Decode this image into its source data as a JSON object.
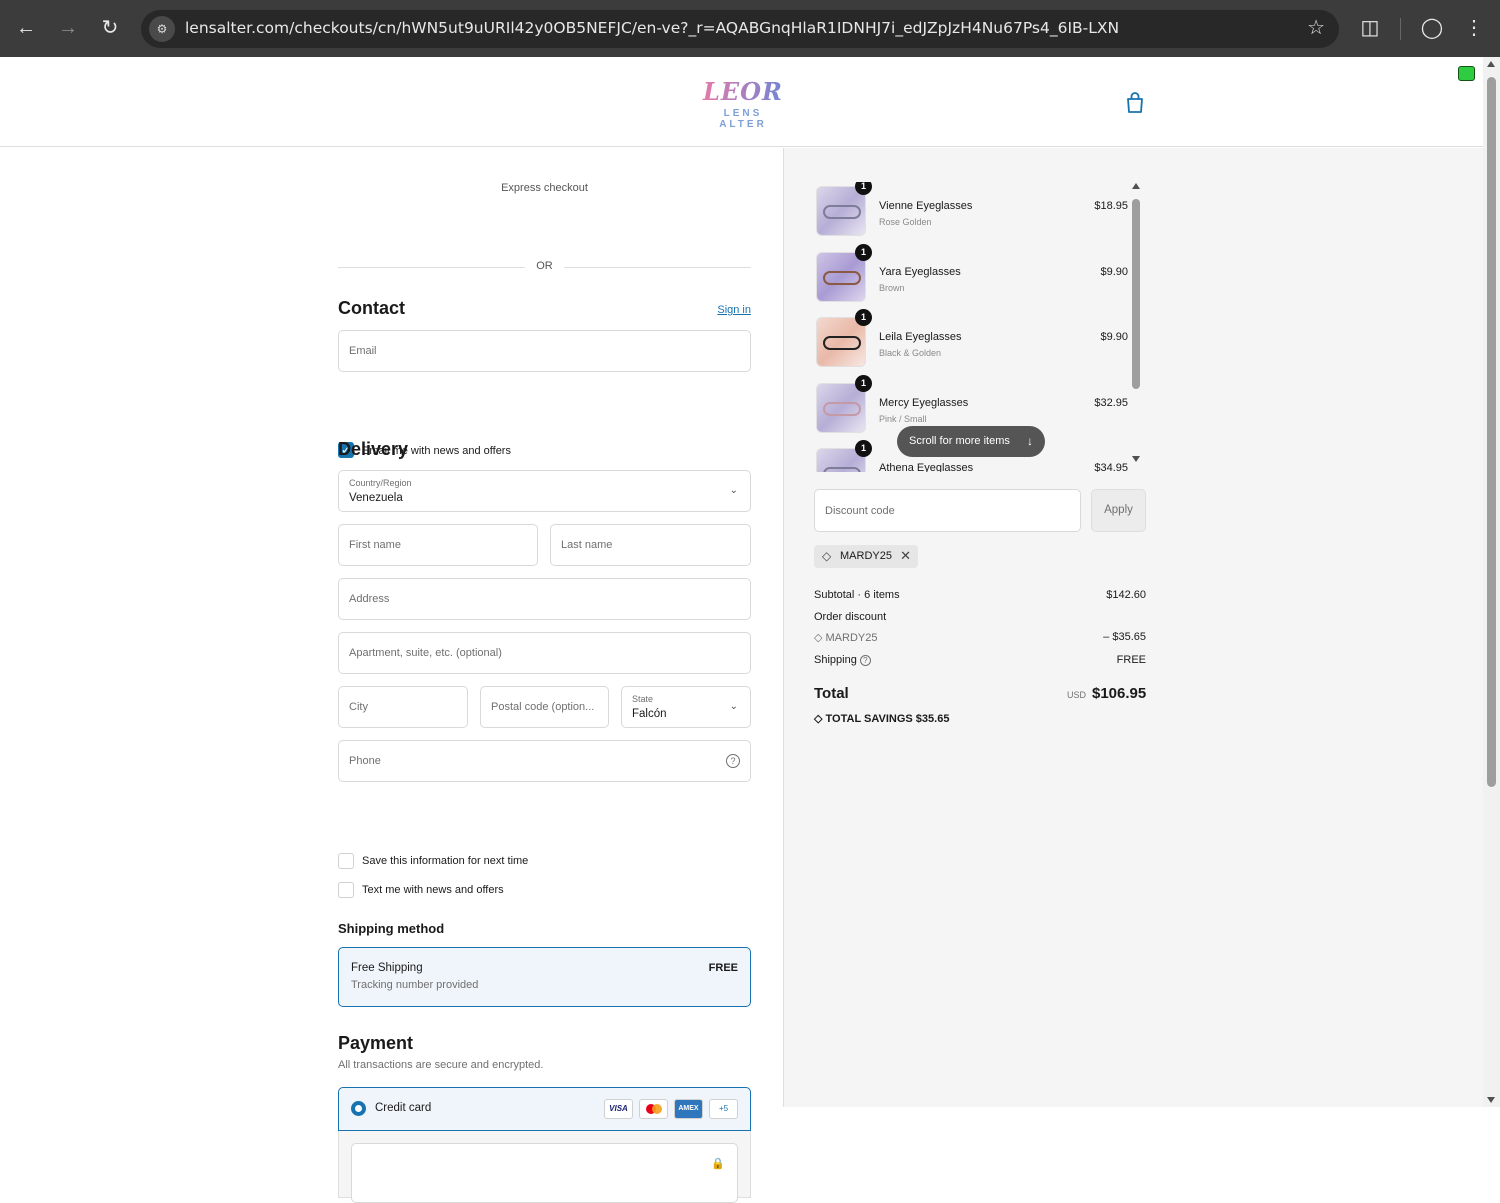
{
  "browser": {
    "url": "lensalter.com/checkouts/cn/hWN5ut9uURIl42y0OB5NEFJC/en-ve?_r=AQABGnqHlaR1IDNHJ7i_edJZpJzH4Nu67Ps4_6IB-LXN",
    "back_icon": "arrow-left-icon",
    "forward_icon": "arrow-right-icon",
    "reload_icon": "reload-icon",
    "bookmark_icon": "star-icon",
    "extensions_icon": "puzzle-icon",
    "profile_icon": "profile-icon",
    "menu_icon": "kebab-menu-icon"
  },
  "header": {
    "logo_mark": "LEOR",
    "logo_word": "LENS ALTER",
    "cart_icon": "shopping-bag-icon"
  },
  "express": {
    "label": "Express checkout",
    "or": "OR"
  },
  "contact": {
    "title": "Contact",
    "signin": "Sign in",
    "email_placeholder": "Email",
    "newsletter_label": "Email me with news and offers",
    "newsletter_checked": true
  },
  "delivery": {
    "title": "Delivery",
    "country_label": "Country/Region",
    "country_value": "Venezuela",
    "first_name_placeholder": "First name",
    "last_name_placeholder": "Last name",
    "address_placeholder": "Address",
    "apartment_placeholder": "Apartment, suite, etc. (optional)",
    "city_placeholder": "City",
    "postal_placeholder": "Postal code (option...",
    "state_label": "State",
    "state_value": "Falcón",
    "phone_placeholder": "Phone",
    "save_info_label": "Save this information for next time",
    "text_me_label": "Text me with news and offers"
  },
  "shipping": {
    "title": "Shipping method",
    "method_name": "Free Shipping",
    "method_sub": "Tracking number provided",
    "method_price": "FREE"
  },
  "payment": {
    "title": "Payment",
    "note": "All transactions are secure and encrypted.",
    "method": "Credit card",
    "badges": [
      "VISA",
      "MC",
      "AMEX",
      "+5"
    ]
  },
  "cart": {
    "items": [
      {
        "qty": "1",
        "name": "Vienne Eyeglasses",
        "variant": "Rose Golden",
        "price": "$18.95"
      },
      {
        "qty": "1",
        "name": "Yara Eyeglasses",
        "variant": "Brown",
        "price": "$9.90"
      },
      {
        "qty": "1",
        "name": "Leila Eyeglasses",
        "variant": "Black & Golden",
        "price": "$9.90"
      },
      {
        "qty": "1",
        "name": "Mercy Eyeglasses",
        "variant": "Pink / Small",
        "price": "$32.95"
      },
      {
        "qty": "1",
        "name": "Athena Eyeglasses",
        "variant": "",
        "price": "$34.95"
      }
    ],
    "scroll_hint": "Scroll for more items"
  },
  "discount": {
    "placeholder": "Discount code",
    "apply": "Apply",
    "applied_code": "MARDY25"
  },
  "summary": {
    "subtotal_label": "Subtotal · 6 items",
    "subtotal_value": "$142.60",
    "order_discount_label": "Order discount",
    "discount_code": "MARDY25",
    "discount_value": "– $35.65",
    "shipping_label": "Shipping",
    "shipping_value": "FREE",
    "total_label": "Total",
    "currency": "USD",
    "total_value": "$106.95",
    "savings_label": "TOTAL SAVINGS",
    "savings_value": "$35.65"
  },
  "colors": {
    "accent": "#1773b0",
    "chrome_bg": "#3c3c3c"
  }
}
